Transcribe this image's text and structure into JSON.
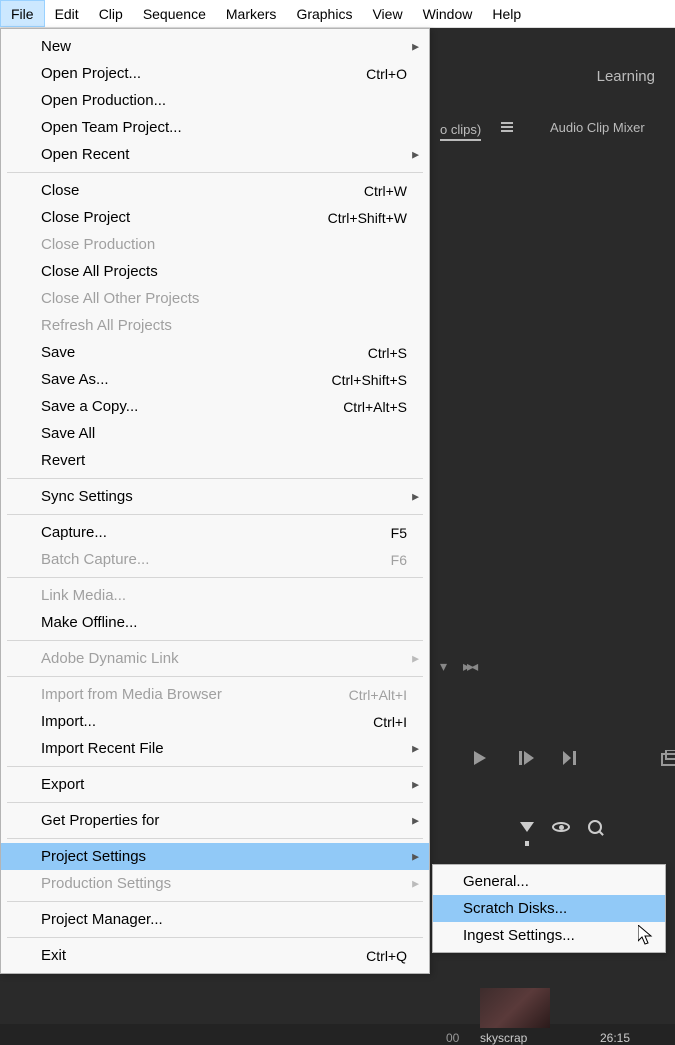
{
  "menubar": {
    "items": [
      {
        "label": "File",
        "active": true
      },
      {
        "label": "Edit"
      },
      {
        "label": "Clip"
      },
      {
        "label": "Sequence"
      },
      {
        "label": "Markers"
      },
      {
        "label": "Graphics"
      },
      {
        "label": "View"
      },
      {
        "label": "Window"
      },
      {
        "label": "Help"
      }
    ]
  },
  "file_menu": {
    "groups": [
      [
        {
          "label": "New",
          "sub": true
        },
        {
          "label": "Open Project...",
          "shortcut": "Ctrl+O"
        },
        {
          "label": "Open Production..."
        },
        {
          "label": "Open Team Project..."
        },
        {
          "label": "Open Recent",
          "sub": true
        }
      ],
      [
        {
          "label": "Close",
          "shortcut": "Ctrl+W"
        },
        {
          "label": "Close Project",
          "shortcut": "Ctrl+Shift+W"
        },
        {
          "label": "Close Production",
          "disabled": true
        },
        {
          "label": "Close All Projects"
        },
        {
          "label": "Close All Other Projects",
          "disabled": true
        },
        {
          "label": "Refresh All Projects",
          "disabled": true
        },
        {
          "label": "Save",
          "shortcut": "Ctrl+S"
        },
        {
          "label": "Save As...",
          "shortcut": "Ctrl+Shift+S"
        },
        {
          "label": "Save a Copy...",
          "shortcut": "Ctrl+Alt+S"
        },
        {
          "label": "Save All"
        },
        {
          "label": "Revert"
        }
      ],
      [
        {
          "label": "Sync Settings",
          "sub": true
        }
      ],
      [
        {
          "label": "Capture...",
          "shortcut": "F5"
        },
        {
          "label": "Batch Capture...",
          "shortcut": "F6",
          "disabled": true
        }
      ],
      [
        {
          "label": "Link Media...",
          "disabled": true
        },
        {
          "label": "Make Offline..."
        }
      ],
      [
        {
          "label": "Adobe Dynamic Link",
          "sub": true,
          "disabled": true
        }
      ],
      [
        {
          "label": "Import from Media Browser",
          "shortcut": "Ctrl+Alt+I",
          "disabled": true
        },
        {
          "label": "Import...",
          "shortcut": "Ctrl+I"
        },
        {
          "label": "Import Recent File",
          "sub": true
        }
      ],
      [
        {
          "label": "Export",
          "sub": true
        }
      ],
      [
        {
          "label": "Get Properties for",
          "sub": true
        }
      ],
      [
        {
          "label": "Project Settings",
          "sub": true,
          "highlight": true
        },
        {
          "label": "Production Settings",
          "sub": true,
          "disabled": true
        }
      ],
      [
        {
          "label": "Project Manager..."
        }
      ],
      [
        {
          "label": "Exit",
          "shortcut": "Ctrl+Q"
        }
      ]
    ]
  },
  "project_settings_submenu": {
    "items": [
      {
        "label": "General..."
      },
      {
        "label": "Scratch Disks...",
        "highlight": true
      },
      {
        "label": "Ingest Settings..."
      }
    ]
  },
  "workspace": {
    "top_tab": "Learning",
    "panel_tab": "o clips)",
    "mixer_tab": "Audio Clip Mixer",
    "clip_name": "skyscrap",
    "clip_duration": "26:15",
    "tc": "00"
  }
}
